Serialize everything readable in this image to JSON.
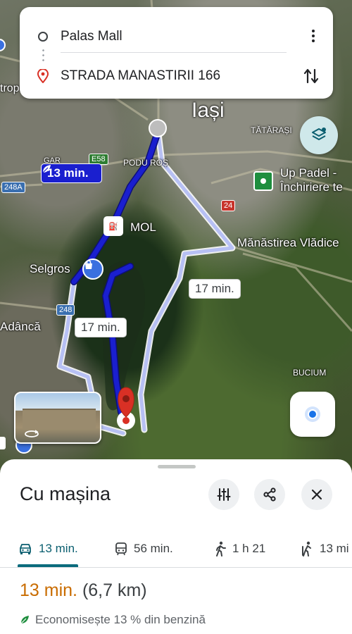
{
  "search": {
    "origin": "Palas Mall",
    "destination": "STRADA MANASTIRII 166"
  },
  "map": {
    "labels": {
      "city": "Iași",
      "tatarasi": "TĂTĂRAȘI",
      "podu_ros": "PODU ROȘ",
      "mol": "MOL",
      "selgros": "Selgros",
      "adanca": "Adâncă",
      "bucium": "BUCIUM",
      "manastirea": "Mănăstirea Vlădice",
      "up_padel_1": "Up Padel -",
      "up_padel_2": "Închiriere te",
      "trop": "trop",
      "gara": "GAR"
    },
    "road_shields": {
      "e58": "E58",
      "r248a": "248A",
      "r24": "24",
      "r248": "248"
    },
    "route_labels": {
      "selected": "13 min.",
      "alt1": "17 min.",
      "alt2": "17 min."
    },
    "colors": {
      "route_selected": "#1a1fcf",
      "route_alt": "#b7c0f4",
      "pin": "#d93025",
      "location_dot": "#1a73e8"
    }
  },
  "sheet": {
    "title": "Cu mașina",
    "tabs": [
      {
        "label": "13 min.",
        "icon": "car-icon"
      },
      {
        "label": "56 min.",
        "icon": "transit-icon"
      },
      {
        "label": "1 h 21",
        "icon": "walk-icon"
      },
      {
        "label": "13 mi",
        "icon": "ride-icon"
      }
    ],
    "duration": "13 min.",
    "distance": "(6,7 km)",
    "eco_text": "Economisește 13 % din benzină"
  }
}
